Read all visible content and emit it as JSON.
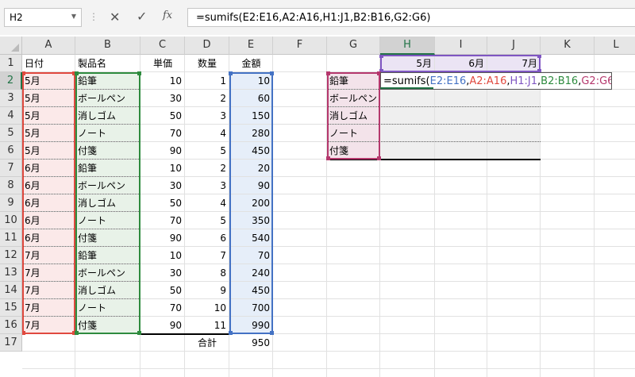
{
  "name_box": "H2",
  "formula_bar": {
    "formula": "=sumifs(E2:E16,A2:A16,H1:J1,B2:B16,G2:G6)",
    "cancel_icon": "✕",
    "enter_icon": "✓",
    "fx_label": "fx"
  },
  "columns": [
    "A",
    "B",
    "C",
    "D",
    "E",
    "F",
    "G",
    "H",
    "I",
    "J",
    "K",
    "L"
  ],
  "rows": [
    "1",
    "2",
    "3",
    "4",
    "5",
    "6",
    "7",
    "8",
    "9",
    "10",
    "11",
    "12",
    "13",
    "14",
    "15",
    "16",
    "17"
  ],
  "headers": {
    "month": "日付",
    "product": "製品名",
    "price": "単価",
    "qty": "数量",
    "amount": "金額"
  },
  "records": [
    {
      "month": "5月",
      "product": "鉛筆",
      "price": "10",
      "qty": "1",
      "amount": "10"
    },
    {
      "month": "5月",
      "product": "ボールペン",
      "price": "30",
      "qty": "2",
      "amount": "60"
    },
    {
      "month": "5月",
      "product": "消しゴム",
      "price": "50",
      "qty": "3",
      "amount": "150"
    },
    {
      "month": "5月",
      "product": "ノート",
      "price": "70",
      "qty": "4",
      "amount": "280"
    },
    {
      "month": "5月",
      "product": "付箋",
      "price": "90",
      "qty": "5",
      "amount": "450"
    },
    {
      "month": "6月",
      "product": "鉛筆",
      "price": "10",
      "qty": "2",
      "amount": "20"
    },
    {
      "month": "6月",
      "product": "ボールペン",
      "price": "30",
      "qty": "3",
      "amount": "90"
    },
    {
      "month": "6月",
      "product": "消しゴム",
      "price": "50",
      "qty": "4",
      "amount": "200"
    },
    {
      "month": "6月",
      "product": "ノート",
      "price": "70",
      "qty": "5",
      "amount": "350"
    },
    {
      "month": "6月",
      "product": "付箋",
      "price": "90",
      "qty": "6",
      "amount": "540"
    },
    {
      "month": "7月",
      "product": "鉛筆",
      "price": "10",
      "qty": "7",
      "amount": "70"
    },
    {
      "month": "7月",
      "product": "ボールペン",
      "price": "30",
      "qty": "8",
      "amount": "240"
    },
    {
      "month": "7月",
      "product": "消しゴム",
      "price": "50",
      "qty": "9",
      "amount": "450"
    },
    {
      "month": "7月",
      "product": "ノート",
      "price": "70",
      "qty": "10",
      "amount": "700"
    },
    {
      "month": "7月",
      "product": "付箋",
      "price": "90",
      "qty": "11",
      "amount": "990"
    }
  ],
  "total": {
    "label": "合計",
    "value": "950"
  },
  "summary": {
    "months": [
      "5月",
      "6月",
      "7月"
    ],
    "products": [
      "鉛筆",
      "ボールペン",
      "消しゴム",
      "ノート",
      "付箋"
    ]
  },
  "editing_cell": {
    "prefix": "=sumifs(",
    "parts": [
      {
        "text": "E2:E16",
        "cls": "f-e"
      },
      {
        "text": ",",
        "cls": ""
      },
      {
        "text": "A2:A16",
        "cls": "f-a"
      },
      {
        "text": ",",
        "cls": ""
      },
      {
        "text": "H1:J1",
        "cls": "f-h"
      },
      {
        "text": ",",
        "cls": ""
      },
      {
        "text": "B2:B16",
        "cls": "f-b"
      },
      {
        "text": ",",
        "cls": ""
      },
      {
        "text": "G2:G6",
        "cls": "f-g"
      },
      {
        "text": ")",
        "cls": ""
      }
    ]
  },
  "colors": {
    "range_e": "#4472c4",
    "range_a": "#e0493f",
    "range_h": "#7f56c2",
    "range_b": "#2e8b3e",
    "range_g": "#b5386d",
    "accent": "#217346"
  }
}
